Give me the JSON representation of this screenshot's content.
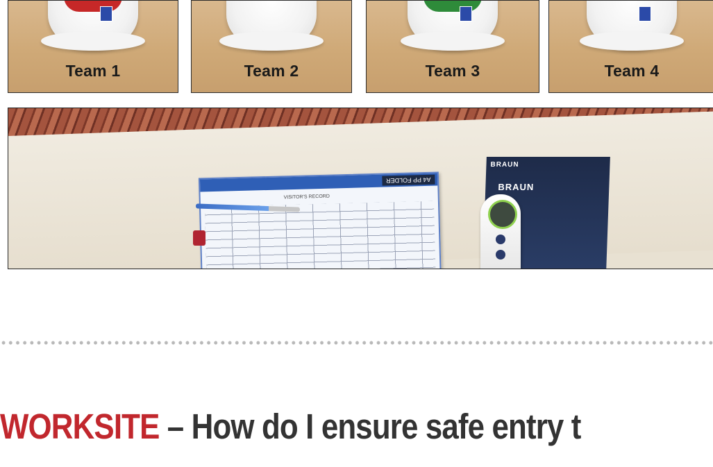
{
  "teams": [
    {
      "label": "Team 1",
      "stripe_color": "#c62828"
    },
    {
      "label": "Team 2",
      "stripe_color": "#ffffff"
    },
    {
      "label": "Team 3",
      "stripe_color": "#2e8b3a"
    },
    {
      "label": "Team 4",
      "stripe_color": "#ffffff"
    }
  ],
  "photo": {
    "folder_tag": "A4 PP FOLDER",
    "sheet_title": "VISITOR'S RECORD",
    "box_brand": "BRAUN",
    "box_brand_front": "BRAUN"
  },
  "heading": {
    "accent": "WORKSITE",
    "rest": " – How do I ensure safe entry t"
  },
  "colors": {
    "accent": "#c1272d",
    "heading_text": "#333333",
    "divider_dots": "#b9b9b9"
  }
}
